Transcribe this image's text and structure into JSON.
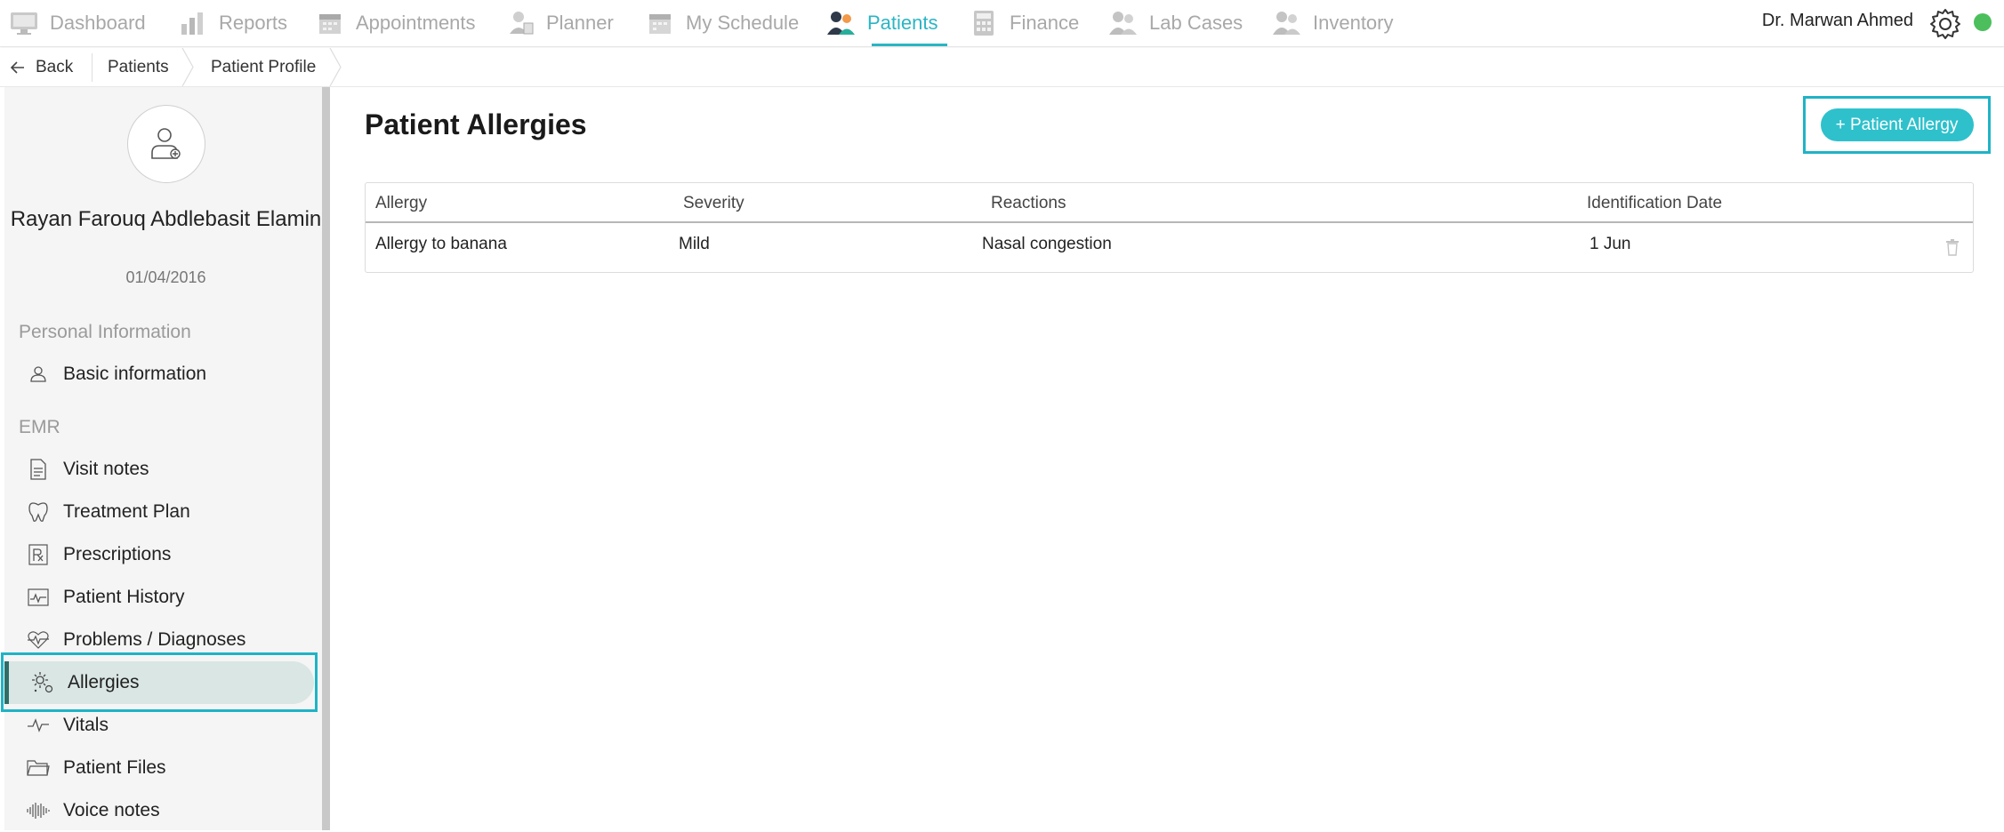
{
  "nav": {
    "items": [
      {
        "label": "Dashboard"
      },
      {
        "label": "Reports"
      },
      {
        "label": "Appointments"
      },
      {
        "label": "Planner"
      },
      {
        "label": "My Schedule"
      },
      {
        "label": "Patients"
      },
      {
        "label": "Finance"
      },
      {
        "label": "Lab Cases"
      },
      {
        "label": "Inventory"
      }
    ],
    "active": "Patients",
    "user": "Dr. Marwan Ahmed",
    "status_color": "#4cbf5c",
    "accent_color": "#2bb5c4"
  },
  "breadcrumb": {
    "back": "Back",
    "items": [
      "Patients",
      "Patient Profile"
    ]
  },
  "patient": {
    "name": "Rayan Farouq Abdlebasit Elamin",
    "dob": "01/04/2016"
  },
  "sidebar": {
    "sections": [
      {
        "title": "Personal Information",
        "items": [
          {
            "label": "Basic information",
            "icon": "person-icon"
          }
        ]
      },
      {
        "title": "EMR",
        "items": [
          {
            "label": "Visit notes",
            "icon": "document-icon"
          },
          {
            "label": "Treatment Plan",
            "icon": "tooth-icon"
          },
          {
            "label": "Prescriptions",
            "icon": "prescription-icon"
          },
          {
            "label": "Patient History",
            "icon": "chart-history-icon"
          },
          {
            "label": "Problems / Diagnoses",
            "icon": "heartbeat-icon"
          },
          {
            "label": "Allergies",
            "icon": "allergen-icon"
          },
          {
            "label": "Vitals",
            "icon": "pulse-icon"
          },
          {
            "label": "Patient Files",
            "icon": "folder-icon"
          },
          {
            "label": "Voice notes",
            "icon": "waveform-icon"
          }
        ]
      }
    ],
    "active": "Allergies"
  },
  "main": {
    "title": "Patient Allergies",
    "add_button": "+ Patient Allergy",
    "table": {
      "headers": [
        "Allergy",
        "Severity",
        "Reactions",
        "Identification Date"
      ],
      "rows": [
        {
          "allergy": "Allergy to banana",
          "severity": "Mild",
          "reactions": "Nasal congestion",
          "date": "1 Jun"
        }
      ]
    }
  }
}
